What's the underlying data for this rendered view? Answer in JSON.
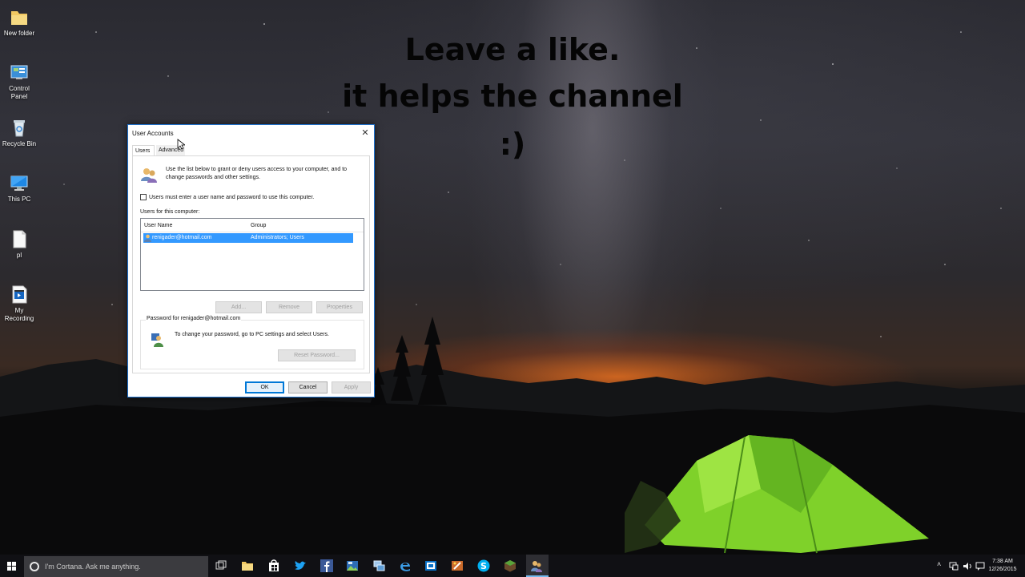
{
  "overlay": {
    "line1": "Leave a like.",
    "line2": "it helps the channel",
    "line3": ":)"
  },
  "desktop_icons": [
    {
      "label": "New folder",
      "icon": "folder-icon"
    },
    {
      "label": "Control Panel",
      "icon": "control-panel-icon"
    },
    {
      "label": "Recycle Bin",
      "icon": "recycle-bin-icon"
    },
    {
      "label": "This PC",
      "icon": "this-pc-icon"
    },
    {
      "label": "pl",
      "icon": "document-icon"
    },
    {
      "label": "My Recording",
      "icon": "video-file-icon"
    }
  ],
  "dialog": {
    "title": "User Accounts",
    "tabs": [
      "Users",
      "Advanced"
    ],
    "intro": "Use the list below to grant or deny users access to your computer, and to change passwords and other settings.",
    "checkbox_label": "Users must enter a user name and password to use this computer.",
    "checkbox_checked": false,
    "users_label": "Users for this computer:",
    "columns": [
      "User Name",
      "Group"
    ],
    "rows": [
      {
        "user": "renigader@hotmail.com",
        "group": "Administrators; Users",
        "selected": true
      }
    ],
    "list_buttons": [
      "Add...",
      "Remove",
      "Properties"
    ],
    "password_group_title": "Password for renigader@hotmail.com",
    "password_text": "To change your password, go to PC settings and select Users.",
    "reset_button": "Reset Password...",
    "ok": "OK",
    "cancel": "Cancel",
    "apply": "Apply"
  },
  "taskbar": {
    "cortana_placeholder": "I'm Cortana. Ask me anything.",
    "pinned_icons": [
      "task-view-icon",
      "file-explorer-icon",
      "store-icon",
      "twitter-icon",
      "facebook-icon",
      "photo-app-icon",
      "network-app-icon",
      "edge-icon",
      "outlook-icon",
      "paint-app-icon",
      "skype-icon",
      "minecraft-icon",
      "user-accounts-icon"
    ],
    "time": "7:38 AM",
    "date": "12/26/2015"
  },
  "colors": {
    "selection": "#3399ff",
    "accent": "#0078d7",
    "taskbar": "#101014"
  }
}
